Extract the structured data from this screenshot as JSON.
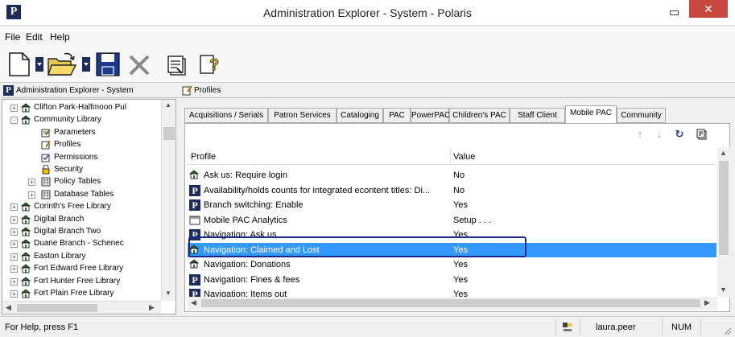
{
  "window": {
    "app_icon": "P",
    "title": "Administration Explorer - System - Polaris",
    "close_label": "✕"
  },
  "menu": [
    "File",
    "Edit",
    "Help"
  ],
  "toolbar": {
    "icons": [
      "new-document-icon",
      "open-folder-icon",
      "save-icon",
      "delete-icon",
      "properties-icon",
      "whats-this-help-icon"
    ]
  },
  "left_pane": {
    "header": "Administration Explorer - System",
    "tree": [
      {
        "label": "Clifton Park-Halfmoon Pul",
        "expander": "+",
        "icon": "library-icon"
      },
      {
        "label": "Community Library",
        "expander": "-",
        "icon": "library-icon"
      },
      {
        "label": "Parameters",
        "expander": "",
        "icon": "parameters-icon"
      },
      {
        "label": "Profiles",
        "expander": "",
        "icon": "profiles-icon"
      },
      {
        "label": "Permissions",
        "expander": "",
        "icon": "permissions-icon"
      },
      {
        "label": "Security",
        "expander": "",
        "icon": "lock-icon"
      },
      {
        "label": "Policy Tables",
        "expander": "+",
        "icon": "table-icon"
      },
      {
        "label": "Database Tables",
        "expander": "+",
        "icon": "table-icon"
      },
      {
        "label": "Corinth's Free Library",
        "expander": "+",
        "icon": "library-icon"
      },
      {
        "label": "Digital Branch",
        "expander": "+",
        "icon": "library-icon"
      },
      {
        "label": "Digital Branch Two",
        "expander": "+",
        "icon": "library-icon"
      },
      {
        "label": "Duane Branch - Schenec",
        "expander": "+",
        "icon": "library-icon"
      },
      {
        "label": "Easton Library",
        "expander": "+",
        "icon": "library-icon"
      },
      {
        "label": "Fort Edward Free Library",
        "expander": "+",
        "icon": "library-icon"
      },
      {
        "label": "Fort Hunter Free Library",
        "expander": "+",
        "icon": "library-icon"
      },
      {
        "label": "Fort Plain Free Library",
        "expander": "+",
        "icon": "library-icon"
      }
    ]
  },
  "right_pane": {
    "header": "Profiles",
    "tabs": [
      {
        "label": "Acquisitions / Serials"
      },
      {
        "label": "Patron Services"
      },
      {
        "label": "Cataloging"
      },
      {
        "label": "PAC"
      },
      {
        "label": "PowerPAC"
      },
      {
        "label": "Children's PAC"
      },
      {
        "label": "Staff Client"
      },
      {
        "label": "Mobile PAC"
      },
      {
        "label": "Community"
      }
    ],
    "active_tab": "Mobile PAC",
    "columns": {
      "profile": "Profile",
      "value": "Value"
    },
    "rows": [
      {
        "profile": "Ask us: Require login",
        "value": "No",
        "icon": "library-icon"
      },
      {
        "profile": "Availability/holds counts for integrated econtent titles: Di...",
        "value": "No",
        "icon": "polaris-p-icon"
      },
      {
        "profile": "Branch switching: Enable",
        "value": "Yes",
        "icon": "polaris-p-icon"
      },
      {
        "profile": "Mobile PAC Analytics",
        "value": "Setup . . .",
        "icon": "analytics-icon"
      },
      {
        "profile": "Navigation: Ask us",
        "value": "Yes",
        "icon": "polaris-p-icon"
      },
      {
        "profile": "Navigation: Claimed and Lost",
        "value": "Yes",
        "icon": "library-icon"
      },
      {
        "profile": "Navigation: Donations",
        "value": "Yes",
        "icon": "library-icon"
      },
      {
        "profile": "Navigation: Fines & fees",
        "value": "Yes",
        "icon": "polaris-p-icon"
      },
      {
        "profile": "Navigation: Items out",
        "value": "Yes",
        "icon": "polaris-p-icon"
      }
    ],
    "selected_row": "Navigation: Claimed and Lost"
  },
  "status": {
    "help": "For Help, press F1",
    "user": "laura.peer",
    "num": "NUM"
  },
  "colors": {
    "selection": "#3399ff",
    "close_button": "#c7463e",
    "polaris_blue": "#1e2c5a",
    "highlight_outline": "#1a2a8a"
  }
}
